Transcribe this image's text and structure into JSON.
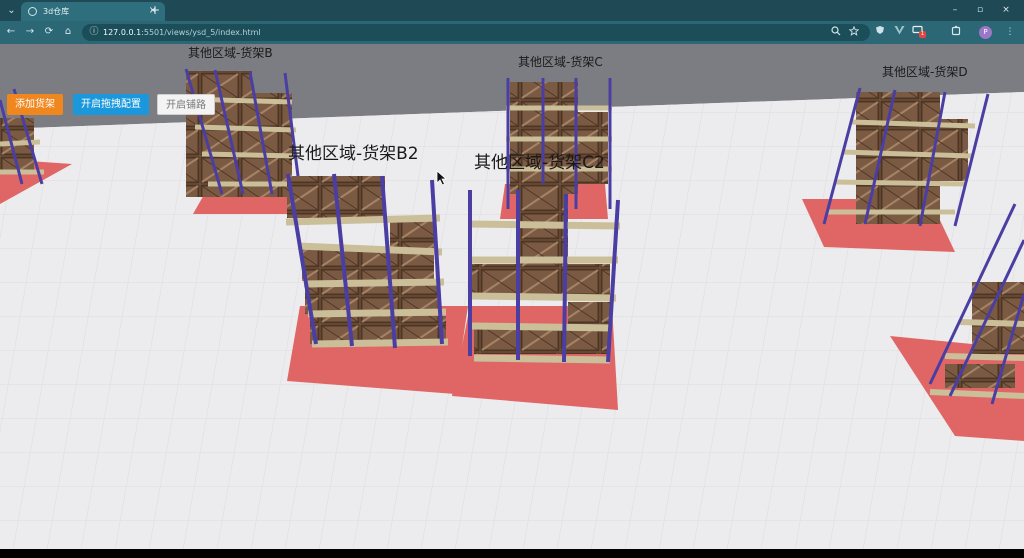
{
  "browser": {
    "tab": {
      "title": "3d仓库",
      "close_glyph": "×"
    },
    "new_tab_glyph": "+",
    "tab_list_glyph": "⌄",
    "window_controls": {
      "minimize": "–",
      "maximize": "▫",
      "close": "×"
    },
    "address": {
      "host": "127.0.0.1",
      "rest": ":5501/views/ysd_5/index.html"
    },
    "nav_glyphs": {
      "back": "←",
      "forward": "→",
      "reload": "⟳",
      "home": "⌂",
      "site_info": "ⓘ"
    },
    "profile_initial": "P",
    "extension_badge": "1",
    "menu_glyph": "⋮"
  },
  "controls": {
    "add_rack": "添加货架",
    "enable_drag": "开启拖拽配置",
    "enable_paving": "开启铺路"
  },
  "rack_labels": {
    "B": "其他区域-货架B",
    "C": "其他区域-货架C",
    "D": "其他区域-货架D",
    "B2": "其他区域-货架B2",
    "C2": "其他区域-货架C2"
  },
  "colors": {
    "tab_bar": "#1f4a55",
    "toolbar": "#2b6775",
    "floor": "#ececee",
    "wall": "#7c7d82",
    "rack_frame": "#4b3ea3",
    "shelf_board": "#cbbf9a",
    "crate": "#7a5a43",
    "floor_marker": "#e06666",
    "btn_orange": "#f0861e",
    "btn_blue": "#1a98db"
  }
}
